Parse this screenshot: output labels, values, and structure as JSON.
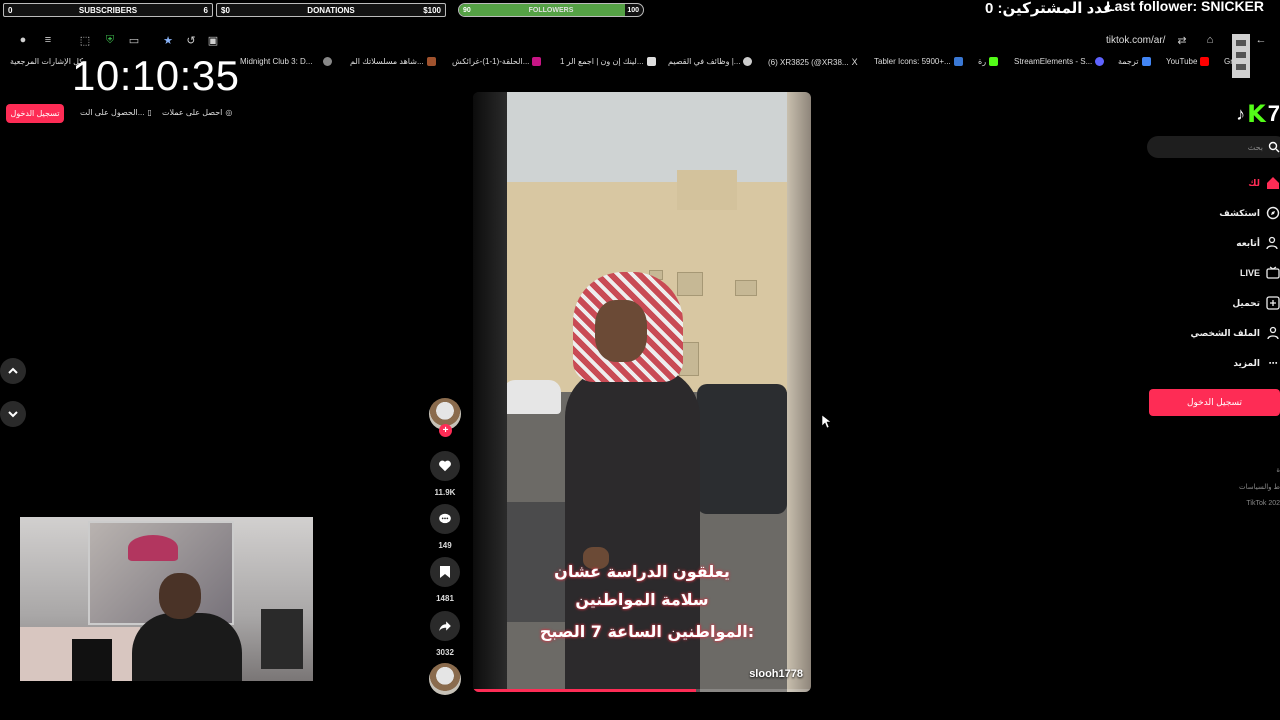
{
  "overlay": {
    "subscribers": {
      "left": "0",
      "label": "SUBSCRIBERS",
      "right": "6"
    },
    "donations": {
      "left": "$0",
      "label": "DONATIONS",
      "right": "$100"
    },
    "followers": {
      "left": "90",
      "label": "FOLLOWERS",
      "right": "100",
      "progress": 0.9
    },
    "subs_count_ar": "عدد المشتركين: 0",
    "last_follower": "Last follower: SNICKER",
    "clock": "10:10:35",
    "accent": "#55a145"
  },
  "browser": {
    "url": "tiktok.com/ar/",
    "bookmarks": [
      {
        "label": "كل الإشارات المرجعية",
        "icon": "folder-icon",
        "color": "#ddd"
      },
      {
        "label": "Midnight Club 3: D...",
        "icon": "page-icon",
        "color": "#888"
      },
      {
        "label": "شاهد مسلسلاتك الم...",
        "icon": "globe-icon",
        "color": "#777"
      },
      {
        "label": "الحلقة-(1-1)-غرائكش...",
        "icon": "film-icon",
        "color": "#a0522d"
      },
      {
        "label": "1 لينك إن ون | اجمع الر...",
        "icon": "link-icon",
        "color": "#c71585"
      },
      {
        "label": "وظائف في القصيم |...",
        "icon": "briefcase-icon",
        "color": "#ddd"
      },
      {
        "label": "(6) XR3825 (@XR38...",
        "icon": "github-icon",
        "color": "#ddd"
      },
      {
        "label": "Tabler Icons: 5900+...",
        "icon": "x-icon",
        "color": "#ddd"
      },
      {
        "label": "رة",
        "icon": "terminal-icon",
        "color": "#3a78d4"
      },
      {
        "label": "StreamElements - S...",
        "icon": "kick-icon",
        "color": "#53fc18"
      },
      {
        "label": "ترجمة",
        "icon": "translate-icon",
        "color": "#5f63ff"
      },
      {
        "label": "YouTube",
        "icon": "google-translate-icon",
        "color": "#4285f4"
      },
      {
        "label": "Gr",
        "icon": "youtube-icon",
        "color": "#ff0000"
      }
    ]
  },
  "tiktok": {
    "top_login": "تسجيل الدخول",
    "top_links": [
      {
        "label": "الحصول على الت...",
        "icon": "phone-icon"
      },
      {
        "label": "احصل على عملات",
        "icon": "coin-icon"
      }
    ],
    "video": {
      "caption_lines": [
        "يعلقون الدراسة عشان",
        "سلامة المواطنين",
        "المواطنين الساعة 7 الصبح:"
      ],
      "username": "slooh1778",
      "progress": 0.66
    },
    "actions": {
      "likes": "11.9K",
      "comments": "149",
      "saves": "1481",
      "shares": "3032"
    },
    "sidebar": {
      "search_placeholder": "بحث",
      "items": [
        {
          "label": "لك",
          "icon": "home-icon",
          "active": true
        },
        {
          "label": "استكشف",
          "icon": "compass-icon",
          "active": false
        },
        {
          "label": "أتابعه",
          "icon": "user-follow-icon",
          "active": false
        },
        {
          "label": "LIVE",
          "icon": "live-icon",
          "active": false
        },
        {
          "label": "تحميل",
          "icon": "upload-icon",
          "active": false
        },
        {
          "label": "الملف الشخصي",
          "icon": "profile-icon",
          "active": false
        },
        {
          "label": "المزيد",
          "icon": "more-icon",
          "active": false
        }
      ],
      "login": "تسجيل الدخول",
      "footer": [
        "ة",
        "ط والسياسات",
        "TikTok 202"
      ]
    }
  }
}
